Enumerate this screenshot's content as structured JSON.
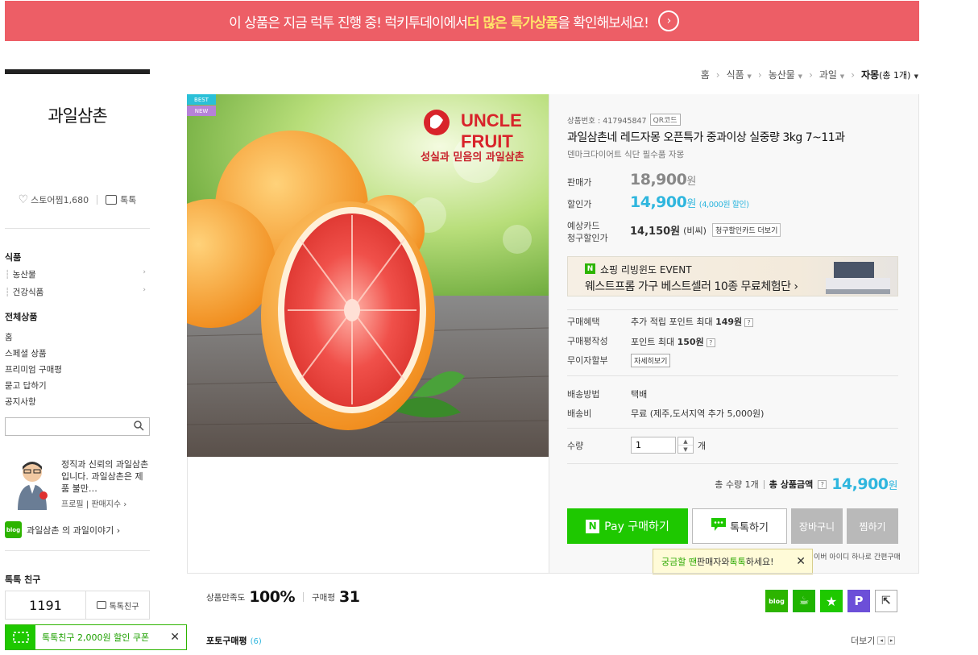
{
  "banner": {
    "part1": "이 상품은 지금 럭투 진행 중! 럭키투데이에서 ",
    "highlight1": "더 많은 특가상품",
    "part2": "을 확인해보세요!",
    "arrow": "›"
  },
  "sidebar": {
    "store_name": "과일삼촌",
    "favorite_label": "스토어찜",
    "favorite_count": "1,680",
    "talk_label": "톡톡",
    "category_title": "식품",
    "categories": [
      {
        "label": "농산물",
        "arrow": "›"
      },
      {
        "label": "건강식품",
        "arrow": "›"
      }
    ],
    "all_products_title": "전체상품",
    "menu": [
      "홈",
      "스페셜 상품",
      "프리미엄 구매평",
      "묻고 답하기",
      "공지사항"
    ],
    "search_placeholder": "",
    "seller_intro": "정직과 신뢰의 과일삼촌입니다. 과일삼촌은 제품 불만…",
    "seller_links": "프로필 | 판매지수 ›",
    "blog_icon": "blog",
    "blog_label": "과일삼촌 의 과일이야기 ›",
    "friend_title": "톡톡 친구",
    "friend_count": "1191",
    "friend_button": "톡톡친구",
    "coupon_text": "톡톡친구 2,000원 할인 쿠폰",
    "coupon_close": "✕"
  },
  "breadcrumb": [
    {
      "label": "홈",
      "dropdown": false
    },
    {
      "label": "식품",
      "dropdown": true
    },
    {
      "label": "농산물",
      "dropdown": true
    },
    {
      "label": "과일",
      "dropdown": true
    },
    {
      "label": "자몽",
      "count": "(총 1개)",
      "dropdown": true
    }
  ],
  "product": {
    "badges": {
      "best": "BEST",
      "new": "NEW"
    },
    "image": {
      "logo_line1": "UNCLE",
      "logo_line2": "FRUIT",
      "logo_slogan": "성실과 믿음의 과일삼촌"
    },
    "product_no": "상품번호 : 417945847",
    "qr_label": "QR코드",
    "title": "과일삼촌네 레드자몽 오픈특가 중과이상 실중량 3kg 7~11과",
    "subtitle": "덴마크다이어트 식단 필수품 자몽",
    "price_label": "판매가",
    "price": "18,900",
    "won": "원",
    "sale_label": "할인가",
    "sale_price": "14,900",
    "discount_note": "(4,000원 할인)",
    "card_label_1": "예상카드",
    "card_label_2": "청구할인가",
    "card_price": "14,150원",
    "card_note": "(비씨)",
    "card_more": "청구할인카드 더보기",
    "event_badge": "N",
    "event_title": "쇼핑 리빙윈도 EVENT",
    "event_text": "웨스트프롬 가구 베스트셀러 10종 무료체험단 ›",
    "benefit_label": "구매혜택",
    "benefit_value_pre": "추가 적립 포인트 최대 ",
    "benefit_value_b": "149원",
    "review_label": "구매평작성",
    "review_value_pre": "포인트 최대 ",
    "review_value_b": "150원",
    "installment_label": "무이자할부",
    "installment_btn": "자세히보기",
    "ship_method_label": "배송방법",
    "ship_method": "택배",
    "ship_fee_label": "배송비",
    "ship_fee": "무료 (제주,도서지역 추가 5,000원)",
    "qty_label": "수량",
    "qty_value": "1",
    "qty_unit": "개",
    "total_qty": "총 수량 1개",
    "total_label": "총 상품금액",
    "total_amount": "14,900",
    "help": "?"
  },
  "buttons": {
    "npay_n": "N",
    "npay": "Pay 구매하기",
    "talk": "톡톡하기",
    "cart": "장바구니",
    "wish": "찜하기"
  },
  "tooltip": {
    "g1": "궁금할 땐",
    "mid": " 판매자와 ",
    "g2": "톡톡",
    "end": "하세요!",
    "close": "✕"
  },
  "naver_note": "이버 아이디 하나로 간편구매",
  "stats": {
    "satisfaction_label": "상품만족도",
    "satisfaction": "100%",
    "reviews_label": "구매평",
    "reviews": "31"
  },
  "share": [
    {
      "icon": "blog-share-icon",
      "text": "blog",
      "color": "#2db400"
    },
    {
      "icon": "cafe-share-icon",
      "text": "☕",
      "color": "#20b400"
    },
    {
      "icon": "star-share-icon",
      "text": "★",
      "color": "#1ec800"
    },
    {
      "icon": "post-share-icon",
      "text": "P",
      "color": "#6c4fd8"
    },
    {
      "icon": "external-share-icon",
      "text": "⇱",
      "color": "#ffffff"
    }
  ],
  "photo_review": {
    "label": "포토구매평",
    "count": "(6)"
  },
  "more_label": "더보기",
  "icons": {
    "heart": "♡",
    "talk": "💬",
    "search": "🔍",
    "prev": "◂",
    "next": "▸",
    "up": "▲",
    "down": "▼"
  }
}
